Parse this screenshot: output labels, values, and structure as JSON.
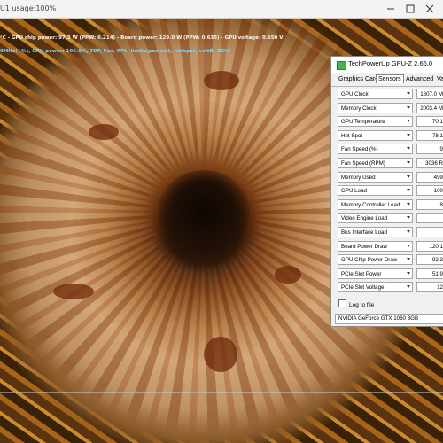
{
  "window": {
    "title_text": "U1 usage:100%"
  },
  "osd": {
    "line1": "°C - GPU chip power: 97.3 W (PPW: 6.214) - Board power: 129.0 W (PPW: 0.635) - GPU voltage: 0.650 V",
    "line2": "0MHz(+%), GPU power: 106.8%, TDP, Fan, RPL, limits(power:1, hotspot, voltB, OCV)"
  },
  "gpuz": {
    "title": "TechPowerUp GPU-Z 2.66.0",
    "tabs": [
      "Graphics Card",
      "Sensors",
      "Advanced",
      "Vali"
    ],
    "active_tab": "Sensors",
    "sensors": [
      {
        "label": "GPU Clock",
        "value": "1607.0 M"
      },
      {
        "label": "Memory Clock",
        "value": "2003.4 M"
      },
      {
        "label": "GPU Temperature",
        "value": "70.1"
      },
      {
        "label": "Hot Spot",
        "value": "78.1"
      },
      {
        "label": "Fan Speed (%)",
        "value": "9"
      },
      {
        "label": "Fan Speed (RPM)",
        "value": "3036 R"
      },
      {
        "label": "Memory Used",
        "value": "499"
      },
      {
        "label": "GPU Load",
        "value": "100"
      },
      {
        "label": "Memory Controller Load",
        "value": "8"
      },
      {
        "label": "Video Engine Load",
        "value": ""
      },
      {
        "label": "Bus Interface Load",
        "value": ""
      },
      {
        "label": "Board Power Draw",
        "value": "120.1"
      },
      {
        "label": "GPU Chip Power Draw",
        "value": "92.3"
      },
      {
        "label": "PCIe Slot Power",
        "value": "51.9"
      },
      {
        "label": "PCIe Slot Voltage",
        "value": "12"
      }
    ],
    "log_label": "Log to file",
    "gpu_select": "NVIDIA GeForce GTX 1060 3GB"
  },
  "colors": {
    "osd_primary": "#f5f5f5",
    "osd_secondary": "#7ad7ff",
    "gpuz_icon": "#4caf50"
  }
}
